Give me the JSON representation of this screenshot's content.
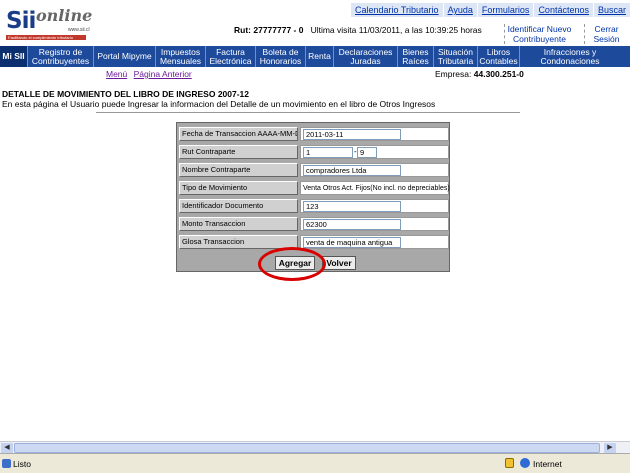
{
  "header": {
    "logo_sii": "Sii",
    "logo_online": "online",
    "logo_url": "www.sii.cl",
    "logo_tag": "Facilitando el cumplimiento tributario",
    "toplinks": [
      "Calendario Tributario",
      "Ayuda",
      "Formularios",
      "Contáctenos",
      "Buscar"
    ],
    "rut_label": "Rut:",
    "rut_value": "27777777 - 0",
    "last_visit": "Ultima visita 11/03/2011, a las 10:39:25 horas",
    "identify_new_line1": "Identificar Nuevo",
    "identify_new_line2": "Contribuyente",
    "close_line1": "Cerrar",
    "close_line2": "Sesión"
  },
  "nav": [
    {
      "l1": "Mi SII",
      "l2": ""
    },
    {
      "l1": "Registro de",
      "l2": "Contribuyentes"
    },
    {
      "l1": "Portal Mipyme",
      "l2": ""
    },
    {
      "l1": "Impuestos",
      "l2": "Mensuales"
    },
    {
      "l1": "Factura",
      "l2": "Electrónica"
    },
    {
      "l1": "Boleta de",
      "l2": "Honorarios"
    },
    {
      "l1": "Renta",
      "l2": ""
    },
    {
      "l1": "Declaraciones",
      "l2": "Juradas"
    },
    {
      "l1": "Bienes",
      "l2": "Raíces"
    },
    {
      "l1": "Situación",
      "l2": "Tributaria"
    },
    {
      "l1": "Libros",
      "l2": "Contables"
    },
    {
      "l1": "Infracciones y",
      "l2": "Condonaciones"
    }
  ],
  "subnav": {
    "menu": "Menú",
    "prev": "Página Anterior"
  },
  "empresa": {
    "label": "Empresa:",
    "value": "44.300.251-0"
  },
  "page": {
    "title": "DETALLE DE MOVIMIENTO DEL LIBRO DE INGRESO 2007-12",
    "description": "En esta página el Usuario puede Ingresar la informacion del Detalle de un movimiento en el libro de Otros Ingresos"
  },
  "form": {
    "fecha_label": "Fecha de Transaccion AAAA-MM-DD",
    "fecha_value": "2011-03-11",
    "rut_label": "Rut Contraparte",
    "rut_number": "1",
    "rut_dv": "9",
    "nombre_label": "Nombre Contraparte",
    "nombre_value": "compradores Ltda",
    "tipo_label": "Tipo de Movimiento",
    "tipo_value": "Venta Otros Act. Fijos(No incl. no depreciables)",
    "ident_label": "Identificador Documento",
    "ident_value": "123",
    "monto_label": "Monto Transaccion",
    "monto_value": "62300",
    "glosa_label": "Glosa Transaccion",
    "glosa_value": "venta de maquina antigua",
    "agregar": "Agregar",
    "volver": "Volver"
  },
  "status": {
    "left": "Listo",
    "zone": "Internet"
  },
  "colors": {
    "nav_bg": "#1e4a9c",
    "highlight_ring": "#d90000"
  }
}
